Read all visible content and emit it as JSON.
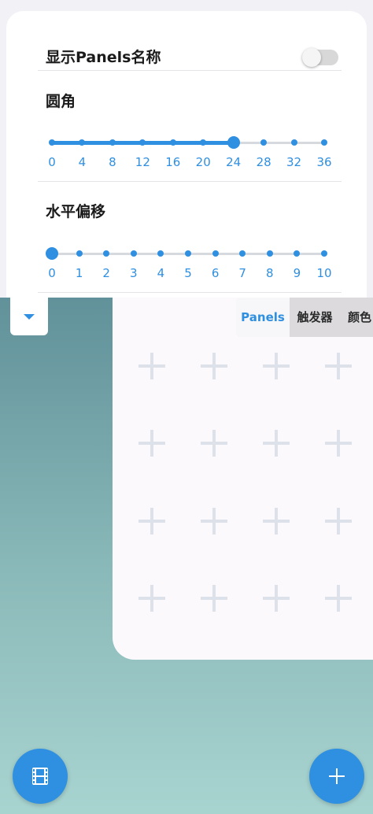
{
  "settings": {
    "show_names_label": "显示Panels名称",
    "show_names_on": false,
    "corner": {
      "label": "圆角",
      "ticks": [
        "0",
        "4",
        "8",
        "12",
        "16",
        "20",
        "24",
        "28",
        "32",
        "36"
      ],
      "value": 24,
      "min": 0,
      "max": 36
    },
    "offset": {
      "label": "水平偏移",
      "ticks": [
        "0",
        "1",
        "2",
        "3",
        "4",
        "5",
        "6",
        "7",
        "8",
        "9",
        "10"
      ],
      "value": 0,
      "min": 0,
      "max": 10
    }
  },
  "tabs": [
    {
      "label": "Panels",
      "active": true
    },
    {
      "label": "触发器",
      "active": false
    },
    {
      "label": "颜色",
      "active": false
    }
  ],
  "icons": {
    "dropdown": "caret-down-icon",
    "add_slot": "plus-icon",
    "left_fab": "film-icon",
    "right_fab": "plus-icon"
  },
  "colors": {
    "accent": "#2f8fe0",
    "slot_plus": "#dce1ea",
    "panel_bg": "#fcf9fc"
  }
}
